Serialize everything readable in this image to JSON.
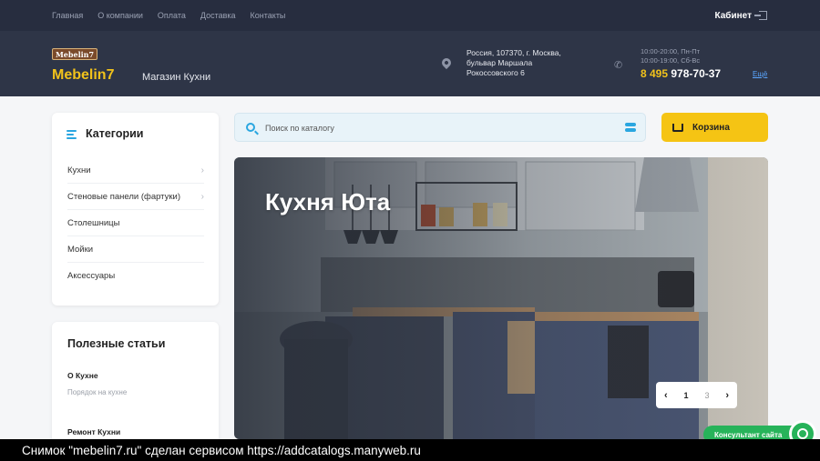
{
  "topnav": {
    "items": [
      "Главная",
      "О компании",
      "Оплата",
      "Доставка",
      "Контакты"
    ],
    "cabinet": "Кабинет"
  },
  "header": {
    "logo_badge": "Mebelin7",
    "logo_text": "Mebelin7",
    "tagline": "Магазин Кухни",
    "address_line1": "Россия, 107370, г. Москва,",
    "address_line2": "бульвар Маршала",
    "address_line3": "Рокоссовского 6",
    "hours_line1": "10:00-20:00, Пн-Пт",
    "hours_line2": "10:00-19:00, Сб-Вс",
    "phone_code": "8 495",
    "phone_number": "978-70-37",
    "more": "Ещё"
  },
  "categories": {
    "title": "Категории",
    "items": [
      {
        "label": "Кухни",
        "has_children": true
      },
      {
        "label": "Стеновые панели (фартуки)",
        "has_children": true
      },
      {
        "label": "Столешницы",
        "has_children": false
      },
      {
        "label": "Мойки",
        "has_children": false
      },
      {
        "label": "Аксессуары",
        "has_children": false
      }
    ]
  },
  "articles": {
    "title": "Полезные статьи",
    "items": [
      {
        "title": "О Кухне",
        "subtitle": "Порядок на кухне"
      },
      {
        "title": "Ремонт Кухни",
        "subtitle": ""
      }
    ]
  },
  "search": {
    "placeholder": "Поиск по каталогу"
  },
  "cart": {
    "label": "Корзина"
  },
  "banner": {
    "title": "Кухня Юта",
    "current_slide": "1",
    "total_slides": "3"
  },
  "consultant": {
    "label": "Консультант сайта"
  },
  "footer": {
    "text": "Снимок \"mebelin7.ru\" сделан сервисом https://addcatalogs.manyweb.ru"
  },
  "colors": {
    "topbar": "#272d3f",
    "header": "#2e3547",
    "accent_yellow": "#f5c414",
    "accent_blue": "#2aa6e0",
    "consult_green": "#27b35a"
  }
}
